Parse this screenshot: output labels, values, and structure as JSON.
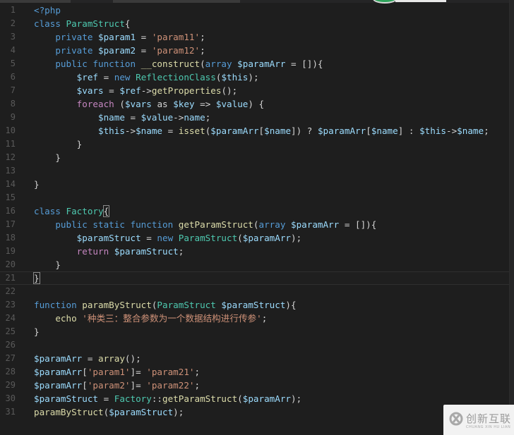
{
  "editor": {
    "language": "php",
    "theme_colors": {
      "background": "#1e1e1e",
      "keyword": "#569cd6",
      "control": "#c586c0",
      "function": "#dcdcaa",
      "class": "#4ec9b0",
      "variable": "#9cdcfe",
      "string": "#ce9178",
      "operator": "#d4d4d4",
      "line_number": "#5a5a5a"
    },
    "current_line": 21,
    "lines": [
      {
        "n": "1",
        "tokens": [
          [
            "kw",
            "<?php"
          ]
        ]
      },
      {
        "n": "2",
        "tokens": [
          [
            "kw",
            "class "
          ],
          [
            "cls",
            "ParamStruct"
          ],
          [
            "op",
            "{"
          ]
        ]
      },
      {
        "n": "3",
        "tokens": [
          [
            "op",
            "    "
          ],
          [
            "kw",
            "private "
          ],
          [
            "var",
            "$param1"
          ],
          [
            "op",
            " = "
          ],
          [
            "str",
            "'param11'"
          ],
          [
            "op",
            ";"
          ]
        ]
      },
      {
        "n": "4",
        "tokens": [
          [
            "op",
            "    "
          ],
          [
            "kw",
            "private "
          ],
          [
            "var",
            "$param2"
          ],
          [
            "op",
            " = "
          ],
          [
            "str",
            "'param12'"
          ],
          [
            "op",
            ";"
          ]
        ]
      },
      {
        "n": "5",
        "tokens": [
          [
            "op",
            "    "
          ],
          [
            "kw",
            "public function "
          ],
          [
            "fn",
            "__construct"
          ],
          [
            "op",
            "("
          ],
          [
            "kw",
            "array "
          ],
          [
            "var",
            "$paramArr"
          ],
          [
            "op",
            " = []){"
          ]
        ]
      },
      {
        "n": "6",
        "tokens": [
          [
            "op",
            "        "
          ],
          [
            "var",
            "$ref"
          ],
          [
            "op",
            " = "
          ],
          [
            "kw",
            "new "
          ],
          [
            "cls",
            "ReflectionClass"
          ],
          [
            "op",
            "("
          ],
          [
            "var",
            "$this"
          ],
          [
            "op",
            ");"
          ]
        ]
      },
      {
        "n": "7",
        "tokens": [
          [
            "op",
            "        "
          ],
          [
            "var",
            "$vars"
          ],
          [
            "op",
            " = "
          ],
          [
            "var",
            "$ref"
          ],
          [
            "op",
            "->"
          ],
          [
            "fn",
            "getProperties"
          ],
          [
            "op",
            "();"
          ]
        ]
      },
      {
        "n": "8",
        "tokens": [
          [
            "op",
            "        "
          ],
          [
            "ctl",
            "foreach "
          ],
          [
            "op",
            "("
          ],
          [
            "var",
            "$vars"
          ],
          [
            "op",
            " as "
          ],
          [
            "var",
            "$key"
          ],
          [
            "op",
            " => "
          ],
          [
            "var",
            "$value"
          ],
          [
            "op",
            ") {"
          ]
        ]
      },
      {
        "n": "9",
        "tokens": [
          [
            "op",
            "            "
          ],
          [
            "var",
            "$name"
          ],
          [
            "op",
            " = "
          ],
          [
            "var",
            "$value"
          ],
          [
            "op",
            "->"
          ],
          [
            "var",
            "name"
          ],
          [
            "op",
            ";"
          ]
        ]
      },
      {
        "n": "10",
        "tokens": [
          [
            "op",
            "            "
          ],
          [
            "var",
            "$this"
          ],
          [
            "op",
            "->"
          ],
          [
            "var",
            "$name"
          ],
          [
            "op",
            " = "
          ],
          [
            "fn",
            "isset"
          ],
          [
            "op",
            "("
          ],
          [
            "var",
            "$paramArr"
          ],
          [
            "op",
            "["
          ],
          [
            "var",
            "$name"
          ],
          [
            "op",
            "]) ? "
          ],
          [
            "var",
            "$paramArr"
          ],
          [
            "op",
            "["
          ],
          [
            "var",
            "$name"
          ],
          [
            "op",
            "] : "
          ],
          [
            "var",
            "$this"
          ],
          [
            "op",
            "->"
          ],
          [
            "var",
            "$name"
          ],
          [
            "op",
            ";"
          ]
        ]
      },
      {
        "n": "11",
        "tokens": [
          [
            "op",
            "        }"
          ]
        ]
      },
      {
        "n": "12",
        "tokens": [
          [
            "op",
            "    }"
          ]
        ]
      },
      {
        "n": "13",
        "tokens": []
      },
      {
        "n": "14",
        "tokens": [
          [
            "op",
            "}"
          ]
        ]
      },
      {
        "n": "15",
        "tokens": []
      },
      {
        "n": "16",
        "tokens": [
          [
            "kw",
            "class "
          ],
          [
            "cls",
            "Factory"
          ],
          [
            "op",
            "{"
          ]
        ]
      },
      {
        "n": "17",
        "tokens": [
          [
            "op",
            "    "
          ],
          [
            "kw",
            "public static function "
          ],
          [
            "fn",
            "getParamStruct"
          ],
          [
            "op",
            "("
          ],
          [
            "kw",
            "array "
          ],
          [
            "var",
            "$paramArr"
          ],
          [
            "op",
            " = []){"
          ]
        ]
      },
      {
        "n": "18",
        "tokens": [
          [
            "op",
            "        "
          ],
          [
            "var",
            "$paramStruct"
          ],
          [
            "op",
            " = "
          ],
          [
            "kw",
            "new "
          ],
          [
            "cls",
            "ParamStruct"
          ],
          [
            "op",
            "("
          ],
          [
            "var",
            "$paramArr"
          ],
          [
            "op",
            ");"
          ]
        ]
      },
      {
        "n": "19",
        "tokens": [
          [
            "op",
            "        "
          ],
          [
            "ctl",
            "return "
          ],
          [
            "var",
            "$paramStruct"
          ],
          [
            "op",
            ";"
          ]
        ]
      },
      {
        "n": "20",
        "tokens": [
          [
            "op",
            "    }"
          ]
        ]
      },
      {
        "n": "21",
        "tokens": [
          [
            "op",
            "}"
          ]
        ]
      },
      {
        "n": "22",
        "tokens": []
      },
      {
        "n": "23",
        "tokens": [
          [
            "kw",
            "function "
          ],
          [
            "fn",
            "paramByStruct"
          ],
          [
            "op",
            "("
          ],
          [
            "cls",
            "ParamStruct "
          ],
          [
            "var",
            "$paramStruct"
          ],
          [
            "op",
            "){"
          ]
        ]
      },
      {
        "n": "24",
        "tokens": [
          [
            "op",
            "    "
          ],
          [
            "fn",
            "echo "
          ],
          [
            "str",
            "'种类三：整合参数为一个数据结构进行传参'"
          ],
          [
            "op",
            ";"
          ]
        ]
      },
      {
        "n": "25",
        "tokens": [
          [
            "op",
            "}"
          ]
        ]
      },
      {
        "n": "26",
        "tokens": []
      },
      {
        "n": "27",
        "tokens": [
          [
            "var",
            "$paramArr"
          ],
          [
            "op",
            " = "
          ],
          [
            "fn",
            "array"
          ],
          [
            "op",
            "();"
          ]
        ]
      },
      {
        "n": "28",
        "tokens": [
          [
            "var",
            "$paramArr"
          ],
          [
            "op",
            "["
          ],
          [
            "str",
            "'param1'"
          ],
          [
            "op",
            "]= "
          ],
          [
            "str",
            "'param21'"
          ],
          [
            "op",
            ";"
          ]
        ]
      },
      {
        "n": "29",
        "tokens": [
          [
            "var",
            "$paramArr"
          ],
          [
            "op",
            "["
          ],
          [
            "str",
            "'param2'"
          ],
          [
            "op",
            "]= "
          ],
          [
            "str",
            "'param22'"
          ],
          [
            "op",
            ";"
          ]
        ]
      },
      {
        "n": "30",
        "tokens": [
          [
            "var",
            "$paramStruct"
          ],
          [
            "op",
            " = "
          ],
          [
            "cls",
            "Factory"
          ],
          [
            "op",
            "::"
          ],
          [
            "fn",
            "getParamStruct"
          ],
          [
            "op",
            "("
          ],
          [
            "var",
            "$paramArr"
          ],
          [
            "op",
            ");"
          ]
        ]
      },
      {
        "n": "31",
        "tokens": [
          [
            "fn",
            "paramByStruct"
          ],
          [
            "op",
            "("
          ],
          [
            "var",
            "$paramStruct"
          ],
          [
            "op",
            ");"
          ]
        ]
      }
    ]
  },
  "watermark": {
    "text": "创新互联",
    "subtext": "CHUANG XIN HU LIAN",
    "icon": "brand-logo-icon"
  },
  "overlay": {
    "icon": "green-status-pill-icon"
  }
}
